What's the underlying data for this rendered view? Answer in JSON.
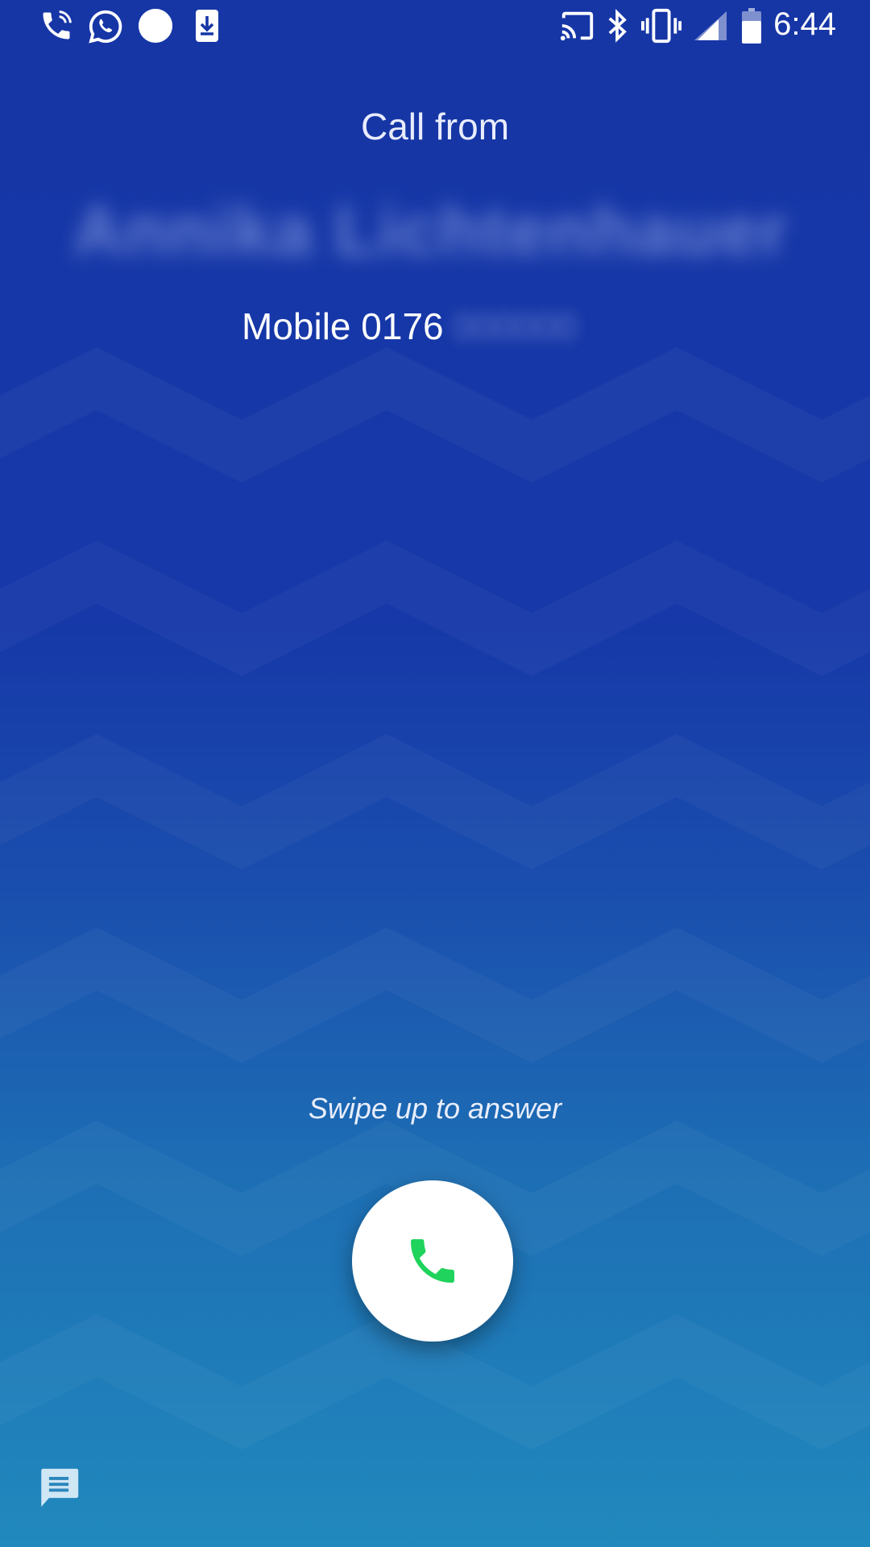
{
  "status_bar": {
    "left_icons": [
      "wifi-call-icon",
      "whatsapp-icon",
      "circle-notification-icon",
      "download-icon"
    ],
    "right_icons": [
      "cast-icon",
      "bluetooth-icon",
      "vibrate-icon",
      "signal-icon",
      "battery-icon"
    ],
    "time": "6:44"
  },
  "call": {
    "heading": "Call from",
    "caller_name": "Annika Lichtenhauer",
    "number_label": "Mobile 0176",
    "number_rest": "000000"
  },
  "answer": {
    "hint": "Swipe up to answer",
    "button_icon": "phone-icon",
    "icon_color": "#1fd35c"
  },
  "quick_reply": {
    "icon": "message-icon"
  },
  "colors": {
    "background_top": "#1636a6",
    "background_bottom": "#2189bd"
  }
}
